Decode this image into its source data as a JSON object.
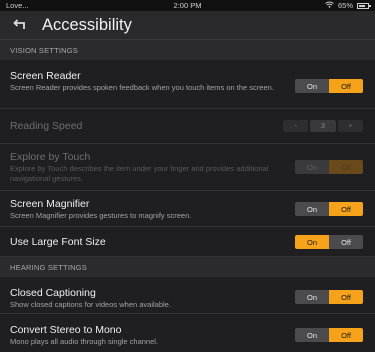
{
  "status_bar": {
    "left": "Love...",
    "time": "2:00 PM",
    "battery": "65%",
    "icons": [
      "wifi-icon",
      "battery-icon"
    ]
  },
  "header": {
    "title": "Accessibility",
    "back_icon": "back-arrow-icon"
  },
  "sections": {
    "vision": "VISION SETTINGS",
    "hearing": "HEARING SETTINGS"
  },
  "rows": {
    "screen_reader": {
      "label": "Screen Reader",
      "desc": "Screen Reader provides spoken feedback when you touch items on the screen.",
      "on": "On",
      "off": "Off",
      "state": "off"
    },
    "reading_speed": {
      "label": "Reading Speed",
      "minus": "-",
      "value": "3",
      "plus": "+"
    },
    "explore_touch": {
      "label": "Explore by Touch",
      "desc": "Explore by Touch describes the item under your finger and provides additional navigational gestures.",
      "on": "On",
      "off": "Off",
      "state": "off"
    },
    "magnifier": {
      "label": "Screen Magnifier",
      "desc": "Screen Magnifier provides gestures to magnify screen.",
      "on": "On",
      "off": "Off",
      "state": "off"
    },
    "large_font": {
      "label": "Use Large Font Size",
      "on": "On",
      "off": "Off",
      "state": "on"
    },
    "captions": {
      "label": "Closed Captioning",
      "desc": "Show closed captions for videos when available.",
      "on": "On",
      "off": "Off",
      "state": "off"
    },
    "mono": {
      "label": "Convert Stereo to Mono",
      "desc": "Mono plays all audio through single channel.",
      "on": "On",
      "off": "Off",
      "state": "off"
    }
  },
  "colors": {
    "accent": "#f7a21b",
    "background": "#1f1f21"
  }
}
